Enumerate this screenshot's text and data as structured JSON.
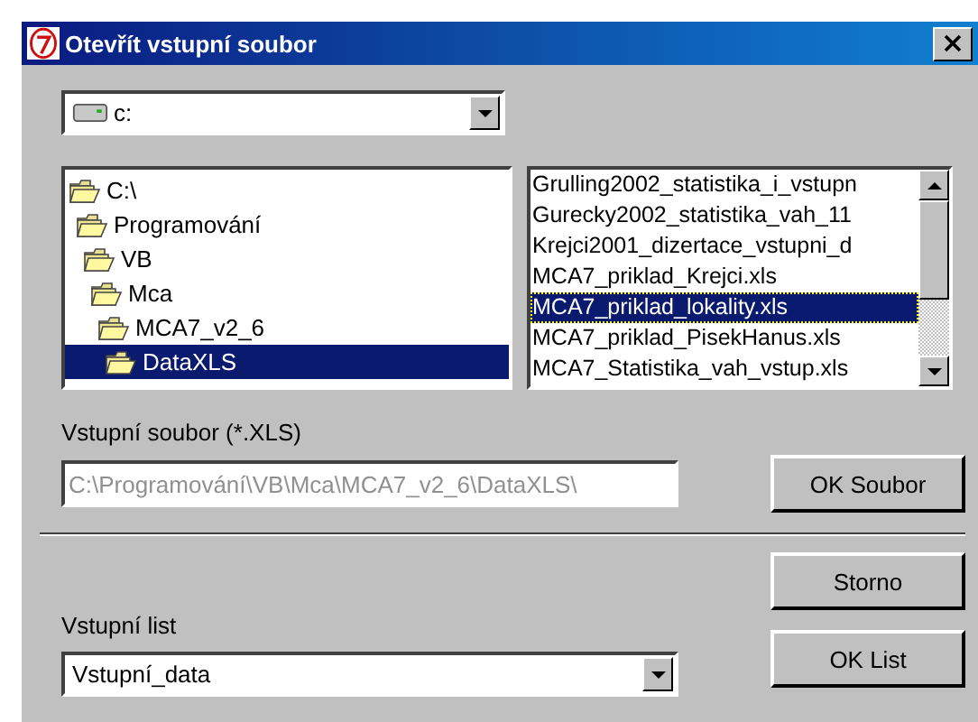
{
  "window": {
    "title": "Otevřít vstupní soubor"
  },
  "drive_combo": {
    "value": "c:"
  },
  "folder_tree": [
    {
      "label": "C:\\",
      "selected": false,
      "children": [
        {
          "label": "Programování",
          "selected": false,
          "children": [
            {
              "label": "VB",
              "selected": false,
              "children": [
                {
                  "label": "Mca",
                  "selected": false,
                  "children": [
                    {
                      "label": "MCA7_v2_6",
                      "selected": false,
                      "children": [
                        {
                          "label": "DataXLS",
                          "selected": true
                        }
                      ]
                    }
                  ]
                }
              ]
            }
          ]
        }
      ]
    }
  ],
  "file_list": [
    {
      "label": "Grulling2002_statistika_i_vstupn",
      "selected": false
    },
    {
      "label": "Gurecky2002_statistika_vah_11",
      "selected": false
    },
    {
      "label": "Krejci2001_dizertace_vstupni_d",
      "selected": false
    },
    {
      "label": "MCA7_priklad_Krejci.xls",
      "selected": false
    },
    {
      "label": "MCA7_priklad_lokality.xls",
      "selected": true
    },
    {
      "label": "MCA7_priklad_PisekHanus.xls",
      "selected": false
    },
    {
      "label": "MCA7_Statistika_vah_vstup.xls",
      "selected": false
    }
  ],
  "input_file": {
    "label": "Vstupní soubor (*.XLS)",
    "value": "C:\\Programování\\VB\\Mca\\MCA7_v2_6\\DataXLS\\",
    "disabled": true
  },
  "ok_file_button": "OK Soubor",
  "cancel_button": "Storno",
  "input_sheet": {
    "label": "Vstupní list",
    "value": "Vstupní_data"
  },
  "ok_sheet_button": "OK List"
}
